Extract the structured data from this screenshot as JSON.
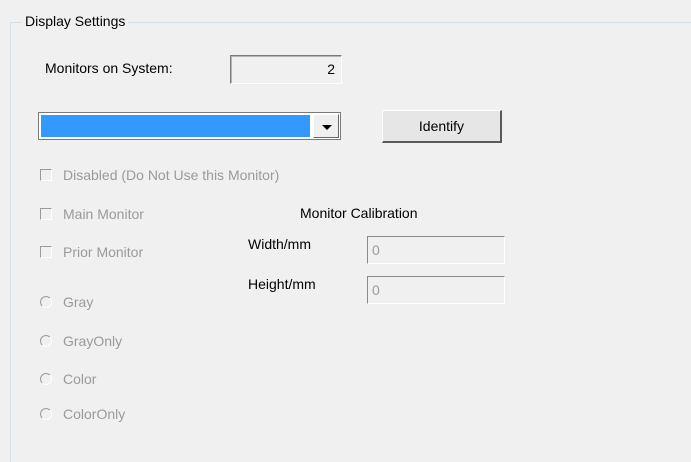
{
  "group": {
    "title": "Display Settings"
  },
  "monitors": {
    "label": "Monitors on System:",
    "value": "2"
  },
  "monitor_select": {
    "selected": ""
  },
  "identify_button": {
    "label": "Identify"
  },
  "checkboxes": [
    {
      "label": "Disabled (Do Not Use this Monitor)"
    },
    {
      "label": "Main Monitor"
    },
    {
      "label": "Prior Monitor"
    }
  ],
  "radios": [
    {
      "label": "Gray"
    },
    {
      "label": "GrayOnly"
    },
    {
      "label": "Color"
    },
    {
      "label": "ColorOnly"
    }
  ],
  "calibration": {
    "title": "Monitor Calibration",
    "width_label": "Width/mm",
    "width_value": "0",
    "height_label": "Height/mm",
    "height_value": "0"
  },
  "colors": {
    "selection": "#3399ff",
    "disabled_text": "#9a9a9a",
    "background": "#f0f0f0"
  }
}
